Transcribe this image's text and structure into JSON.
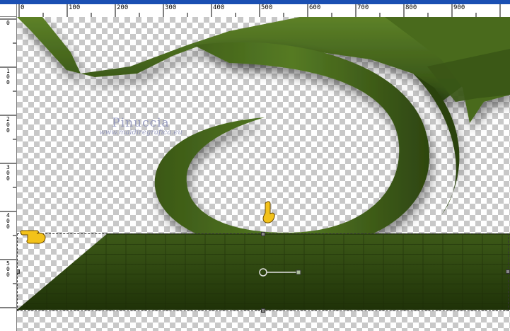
{
  "ruler": {
    "horizontal_labels": [
      "0",
      "100",
      "200",
      "300",
      "400",
      "500",
      "600",
      "700",
      "800",
      "900"
    ],
    "vertical_labels": [
      "0",
      "100",
      "200",
      "300",
      "400",
      "500"
    ]
  },
  "watermark": {
    "name": "Pinuccia",
    "url": "www.maidiregrafica.eu"
  },
  "colors": {
    "ruler_strip": "#1a4fb3",
    "shape_green": "#4a6b1e",
    "floor_green": "#2f4a14",
    "checker": "#c8c8c8"
  },
  "icons": [
    "pointing-hand-icon",
    "pointing-hand-icon",
    "deformation-pivot-icon"
  ]
}
